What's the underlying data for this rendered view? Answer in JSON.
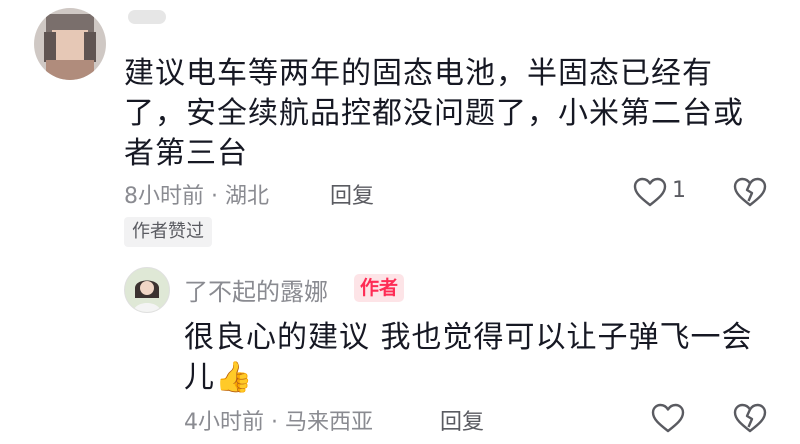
{
  "comment": {
    "text": "建议电车等两年的固态电池，半固态已经有了，安全续航品控都没问题了，小米第二台或者第三台",
    "time": "8小时前",
    "location": "湖北",
    "reply_label": "回复",
    "like_count": "1",
    "author_liked_badge": "作者赞过",
    "icons": [
      "heart-icon",
      "broken-heart-icon"
    ]
  },
  "reply": {
    "username": "了不起的露娜",
    "author_tag": "作者",
    "text": "很良心的建议 我也觉得可以让子弹飞一会儿",
    "emoji": "👍",
    "time": "4小时前",
    "location": "马来西亚",
    "reply_label": "回复",
    "icons": [
      "heart-icon",
      "broken-heart-icon"
    ]
  },
  "colors": {
    "accent": "#fe2c55",
    "muted": "#8a8b91"
  }
}
